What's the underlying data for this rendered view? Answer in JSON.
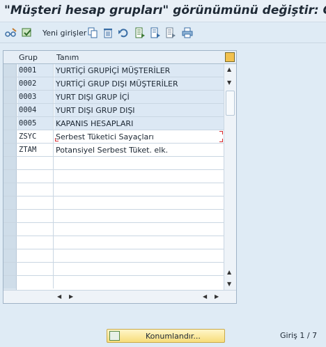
{
  "window": {
    "title": "\"Müşteri hesap grupları\" görünümünü değiştir: Genel"
  },
  "toolbar": {
    "new_entries_label": "Yeni girişler",
    "icons": [
      "glasses-edit-icon",
      "display-change-icon",
      "copy-icon",
      "delete-icon",
      "undo-icon",
      "select-all-icon",
      "select-block-icon",
      "deselect-all-icon",
      "print-icon"
    ]
  },
  "table": {
    "columns": [
      "Grup",
      "Tanım"
    ],
    "rows": [
      {
        "grup": "0001",
        "tanim": "YURTİÇİ GRUPİÇİ MÜŞTERİLER",
        "editable": false
      },
      {
        "grup": "0002",
        "tanim": "YURTİÇİ GRUP DIŞI MÜŞTERİLER",
        "editable": false
      },
      {
        "grup": "0003",
        "tanim": "YURT DIŞI GRUP İÇİ",
        "editable": false
      },
      {
        "grup": "0004",
        "tanim": "YURT DIŞI GRUP DIŞI",
        "editable": false
      },
      {
        "grup": "0005",
        "tanim": "KAPANIS HESAPLARI",
        "editable": false
      },
      {
        "grup": "ZSYC",
        "tanim": "Serbest Tüketici Sayaçları",
        "editable": true
      },
      {
        "grup": "ZTAM",
        "tanim": "Potansiyel Serbest Tüket. elk.",
        "editable": true
      }
    ],
    "empty_rows": 10
  },
  "footer": {
    "position_button_label": "Konumlandır...",
    "entry_status": "Giriş 1 / 7"
  },
  "colors": {
    "background": "#dfebf5",
    "row_readonly": "#dce8f4",
    "button": "#f7dd7a",
    "cursor_marker": "#d7262b"
  }
}
